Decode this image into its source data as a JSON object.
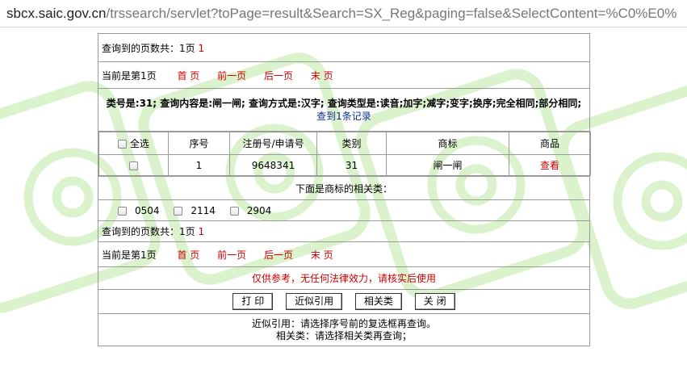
{
  "browser": {
    "url_host": "sbcx.saic.gov.cn",
    "url_path": "/trssearch/servlet?toPage=result&Search=SX_Reg&paging=false&SelectContent=%C0%E0%"
  },
  "pager_top": {
    "total_label": "查询到的页数共：1页",
    "total_page": "1",
    "current": "当前是第1页",
    "first": "首 页",
    "prev": "前一页",
    "next": "后一页",
    "last": "末 页"
  },
  "criteria": {
    "text": "类号是:31; 查询内容是:闸一闸; 查询方式是:汉字; 查询类型是:读音;加字;减字;变字;换序;完全相同;部分相同;",
    "found": "查到1条记录"
  },
  "table": {
    "headers": {
      "select_all": "全选",
      "seq": "序号",
      "reg_no": "注册号/申请号",
      "class": "类别",
      "mark": "商标",
      "goods": "商品"
    },
    "rows": [
      {
        "seq": "1",
        "reg_no": "9648341",
        "class": "31",
        "mark": "闸一闸",
        "view": "查看"
      }
    ]
  },
  "related": {
    "title": "下面是商标的相关类：",
    "classes": [
      "0504",
      "2114",
      "2904"
    ]
  },
  "pager_bottom": {
    "total_label": "查询到的页数共：1页",
    "total_page": "1",
    "current": "当前是第1页",
    "first": "首 页",
    "prev": "前一页",
    "next": "后一页",
    "last": "末 页"
  },
  "disclaimer": "仅供参考，无任何法律效力，请核实后使用",
  "buttons": {
    "print": "打 印",
    "similar": "近似引用",
    "related": "相关类",
    "close": "关 闭"
  },
  "notes": {
    "similar": "近似引用：请选择序号前的复选框再查询。",
    "related": "相关类：请选择相关类再查询；"
  },
  "colors": {
    "link_red": "#cc0000",
    "found_blue": "#0b2e91",
    "watermark_green": "#d9f2c9"
  }
}
